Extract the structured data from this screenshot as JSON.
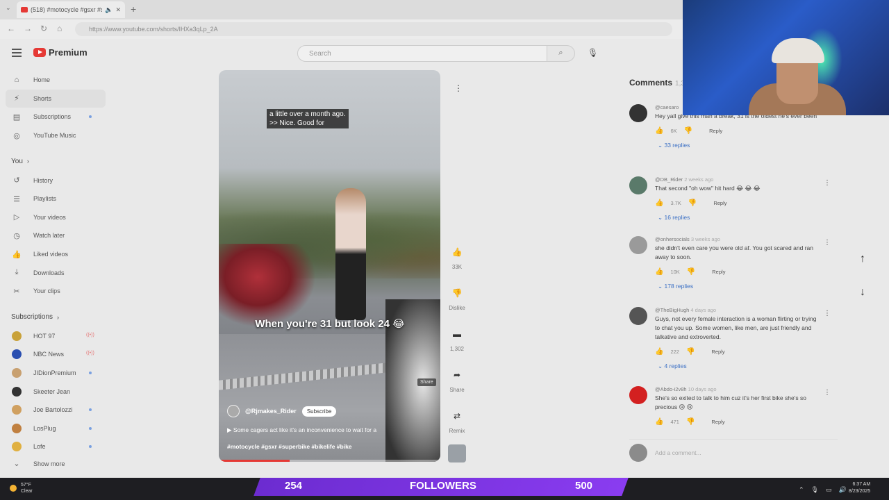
{
  "browser": {
    "tab_title": "(518) #motocycle #gsxr #su",
    "url": "https://www.youtube.com/shorts/IHXa3qLp_2A"
  },
  "header": {
    "brand": "Premium",
    "search_placeholder": "Search"
  },
  "sidebar": {
    "items": [
      {
        "label": "Home",
        "icon": "home-icon"
      },
      {
        "label": "Shorts",
        "icon": "shorts-icon"
      },
      {
        "label": "Subscriptions",
        "icon": "subscriptions-icon"
      },
      {
        "label": "YouTube Music",
        "icon": "music-icon"
      }
    ],
    "you_label": "You",
    "you_items": [
      {
        "label": "History"
      },
      {
        "label": "Playlists"
      },
      {
        "label": "Your videos"
      },
      {
        "label": "Watch later"
      },
      {
        "label": "Liked videos"
      },
      {
        "label": "Downloads"
      },
      {
        "label": "Your clips"
      }
    ],
    "subs_label": "Subscriptions",
    "subs": [
      {
        "label": "HOT 97",
        "color": "#c9a23a"
      },
      {
        "label": "NBC News",
        "color": "#2a4fb0"
      },
      {
        "label": "JIDionPremium",
        "color": "#c8a070"
      },
      {
        "label": "Skeeter Jean",
        "color": "#333333"
      },
      {
        "label": "Joe Bartolozzi",
        "color": "#d0a060"
      },
      {
        "label": "LosPlug",
        "color": "#c08040"
      },
      {
        "label": "Lofe",
        "color": "#e0b040"
      }
    ],
    "show_more": "Show more"
  },
  "video": {
    "caption_line1": "a little over a month ago.",
    "caption_line2": ">> Nice. Good for",
    "overlay_text": "When you're 31 but look 24 😂",
    "share_chip": "Share",
    "channel": "@Rjmakes_Rider",
    "subscribe": "Subscribe",
    "description": "Some cagers act like it's an inconvenience to wait for a",
    "tags": "#motocycle #gsxr #superbike #bikelife #bike",
    "progress": 0.32
  },
  "actions": {
    "likes": "33K",
    "dislike": "Dislike",
    "comments": "1,302",
    "share": "Share",
    "remix": "Remix"
  },
  "comments": {
    "title": "Comments",
    "count": "1,3",
    "items": [
      {
        "user": "@caesaro",
        "ago": "",
        "text": "Hey yall give this man a break, 31 is the oldest he's ever been",
        "likes": "6K",
        "replies": "33 replies",
        "avatar": "#333333"
      },
      {
        "user": "@DB_Rider",
        "ago": "2 weeks ago",
        "text": "That second \"oh wow\" hit hard 😂 😂 😂",
        "likes": "3.7K",
        "replies": "16 replies",
        "avatar": "#5a7a6a"
      },
      {
        "user": "@onhersocials",
        "ago": "3 weeks ago",
        "text": "she didn't even care you were old af. You got scared and ran away to soon.",
        "likes": "10K",
        "replies": "178 replies",
        "avatar": "#9a9a9a"
      },
      {
        "user": "@TheBigHugh",
        "ago": "4 days ago",
        "text": "Guys, not every female interaction is a woman flirting or trying to chat you up. Some women, like men, are just friendly and talkative and extroverted.",
        "likes": "222",
        "replies": "4 replies",
        "avatar": "#555555"
      },
      {
        "user": "@Abdo-i2v8h",
        "ago": "10 days ago",
        "text": "She's so exited to talk to him cuz it's her first bike she's so precious 😢 😢",
        "likes": "471",
        "replies": "",
        "avatar": "#d32020"
      }
    ],
    "reply_label": "Reply",
    "add_placeholder": "Add a comment..."
  },
  "taskbar": {
    "temp": "57°F",
    "weather": "Clear",
    "count_left": "254",
    "followers": "FOLLOWERS",
    "count_right": "500",
    "time": "6:37 AM",
    "date": "8/23/2025"
  }
}
